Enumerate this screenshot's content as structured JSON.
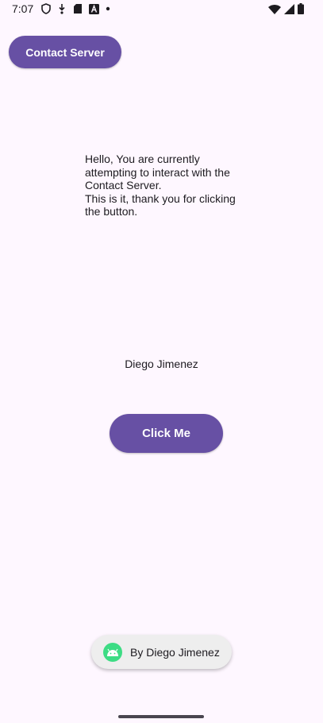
{
  "status_bar": {
    "time": "7:07",
    "left_icons": [
      "shield-icon",
      "download-icon",
      "sd-card-icon",
      "font-icon",
      "dot-icon"
    ],
    "right_icons": [
      "wifi-icon",
      "signal-icon",
      "battery-icon"
    ]
  },
  "toolbar": {
    "contact_server_label": "Contact Server"
  },
  "message": {
    "line1": "Hello, You are currently attempting to interact with the Contact Server.",
    "line2": "This is it, thank you for clicking the button."
  },
  "author": {
    "name": "Diego Jimenez"
  },
  "actions": {
    "click_me_label": "Click Me"
  },
  "toast": {
    "icon": "android-icon",
    "text": "By Diego Jimenez"
  },
  "colors": {
    "background": "#fef7ff",
    "primary": "#6750a4",
    "on_primary": "#ffffff",
    "toast_background": "#eeeeee",
    "android_green": "#3ddc84"
  }
}
